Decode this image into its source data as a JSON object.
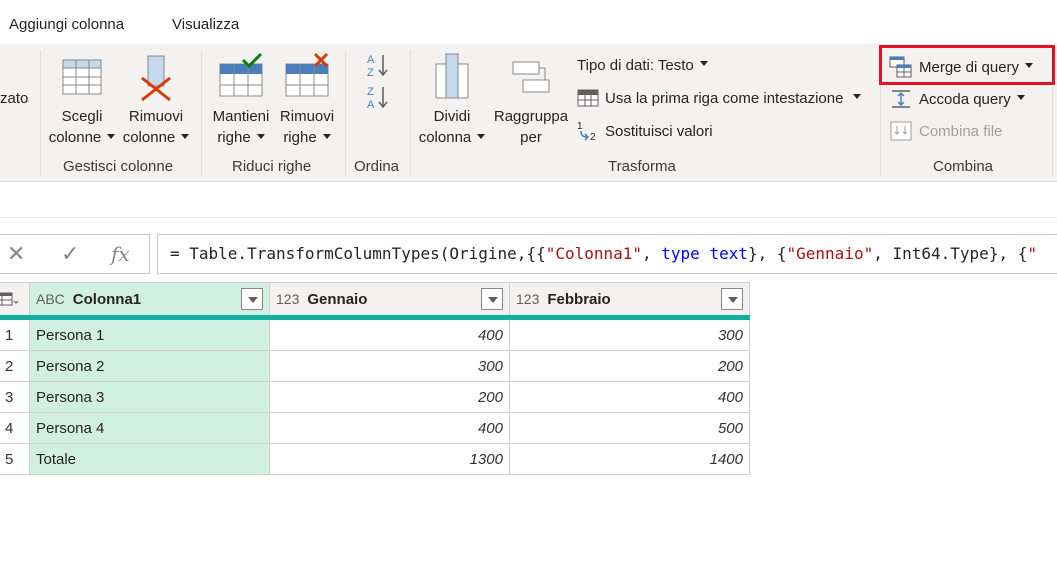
{
  "tabs": [
    "Aggiungi colonna",
    "Visualizza"
  ],
  "ribbon": {
    "cut_label": "zato",
    "gestisci": {
      "label": "Gestisci colonne",
      "scegli_l1": "Scegli",
      "scegli_l2": "colonne",
      "rimuovi_l1": "Rimuovi",
      "rimuovi_l2": "colonne"
    },
    "riduci": {
      "label": "Riduci righe",
      "mantieni_l1": "Mantieni",
      "mantieni_l2": "righe",
      "rimuovi_l1": "Rimuovi",
      "rimuovi_l2": "righe"
    },
    "ordina": {
      "label": "Ordina"
    },
    "trasforma": {
      "label": "Trasforma",
      "dividi_l1": "Dividi",
      "dividi_l2": "colonna",
      "raggruppa_l1": "Raggruppa",
      "raggruppa_l2": "per",
      "tipo_dati": "Tipo di dati: Testo",
      "prima_riga": "Usa la prima riga come intestazione",
      "sostituisci": "Sostituisci valori"
    },
    "combina": {
      "label": "Combina",
      "merge": "Merge di query",
      "accoda": "Accoda query",
      "combina_file": "Combina file"
    }
  },
  "formula_bar": {
    "fx": "fx",
    "p1": "= Table.TransformColumnTypes(Origine,{{",
    "s1": "\"Colonna1\"",
    "p2": ", ",
    "k1": "type",
    "p3": " ",
    "k2": "text",
    "p4": "}, {",
    "s2": "\"Gennaio\"",
    "p5": ", Int64.Type}, {",
    "s3": "\""
  },
  "table": {
    "columns": [
      {
        "type": "ABC",
        "name": "Colonna1"
      },
      {
        "type": "123",
        "name": "Gennaio"
      },
      {
        "type": "123",
        "name": "Febbraio"
      }
    ],
    "rows": [
      {
        "n": "1",
        "c": "Persona 1",
        "g": "400",
        "f": "300"
      },
      {
        "n": "2",
        "c": "Persona 2",
        "g": "300",
        "f": "200"
      },
      {
        "n": "3",
        "c": "Persona 3",
        "g": "200",
        "f": "400"
      },
      {
        "n": "4",
        "c": "Persona 4",
        "g": "400",
        "f": "500"
      },
      {
        "n": "5",
        "c": "Totale",
        "g": "1300",
        "f": "1400"
      }
    ]
  },
  "colors": {
    "highlight": "#e81123",
    "accent_teal": "#12b0a0",
    "selected_column": "#d2f0e1"
  }
}
